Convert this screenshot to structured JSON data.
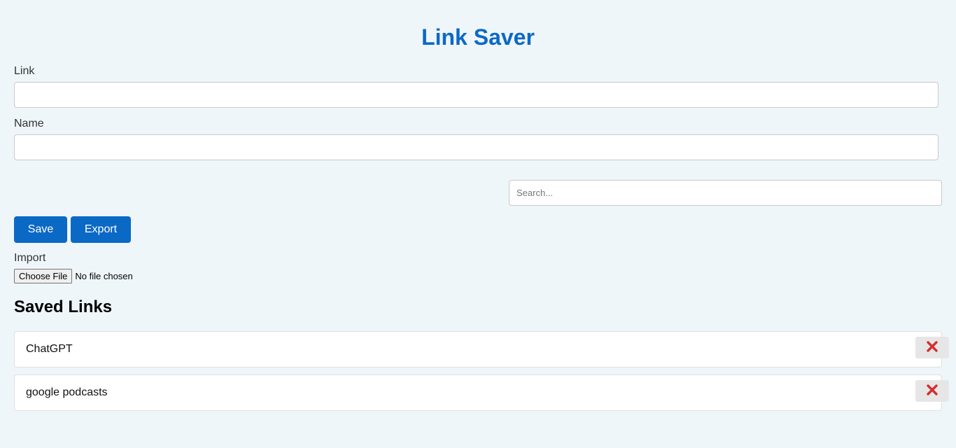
{
  "app": {
    "title": "Link Saver"
  },
  "form": {
    "link_label": "Link",
    "link_value": "",
    "name_label": "Name",
    "name_value": ""
  },
  "search": {
    "placeholder": "Search...",
    "value": ""
  },
  "toolbar": {
    "save_label": "Save",
    "export_label": "Export"
  },
  "import": {
    "label": "Import",
    "choose_label": "Choose File",
    "status": "No file chosen"
  },
  "saved": {
    "heading": "Saved Links",
    "items": [
      {
        "name": "ChatGPT",
        "delete_icon": "red-x-icon"
      },
      {
        "name": "google podcasts",
        "delete_icon": "red-x-icon"
      }
    ]
  },
  "colors": {
    "accent": "#0b69c6",
    "background": "#eff6fa",
    "delete_icon": "#d32f2f"
  }
}
